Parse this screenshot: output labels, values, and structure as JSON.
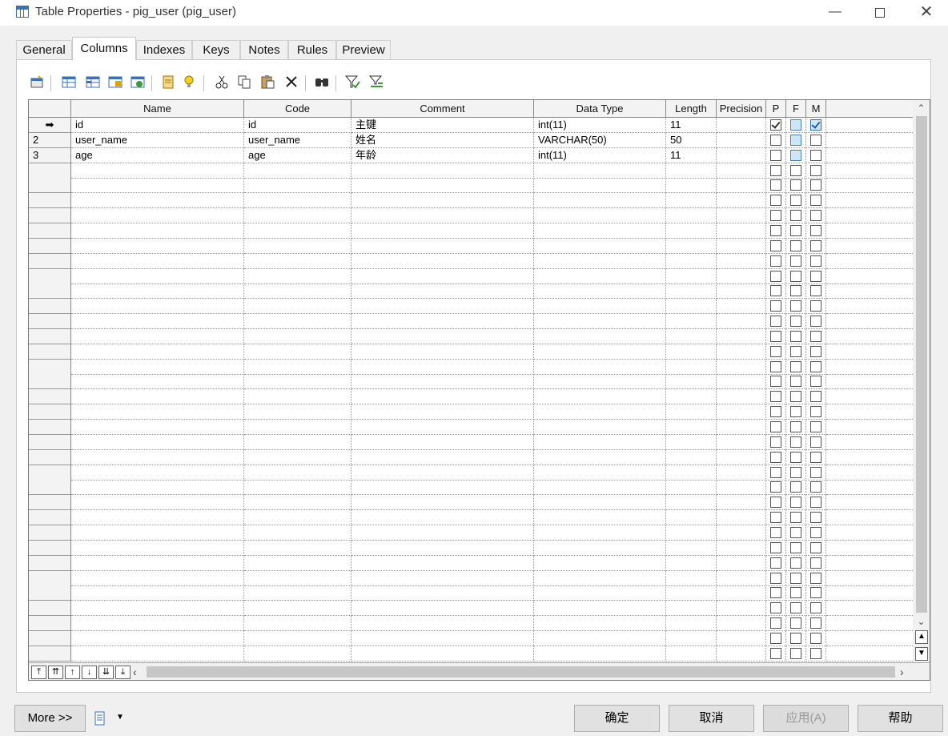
{
  "window": {
    "title": "Table Properties - pig_user (pig_user)"
  },
  "tabs": [
    "General",
    "Columns",
    "Indexes",
    "Keys",
    "Notes",
    "Rules",
    "Preview"
  ],
  "active_tab": "Columns",
  "grid": {
    "headers": [
      "Name",
      "Code",
      "Comment",
      "Data Type",
      "Length",
      "Precision",
      "P",
      "F",
      "M"
    ],
    "rows": [
      {
        "marker": "➡",
        "name": "id",
        "code": "id",
        "comment": "主键",
        "data_type": "int(11)",
        "length": "11",
        "precision": "",
        "p": true,
        "f": false,
        "m": true
      },
      {
        "marker": "2",
        "name": "user_name",
        "code": "user_name",
        "comment": "姓名",
        "data_type": "VARCHAR(50)",
        "length": "50",
        "precision": "",
        "p": false,
        "f": false,
        "m": false
      },
      {
        "marker": "3",
        "name": "age",
        "code": "age",
        "comment": "年龄",
        "data_type": "int(11)",
        "length": "11",
        "precision": "",
        "p": false,
        "f": false,
        "m": false
      }
    ]
  },
  "buttons": {
    "more": "More >>",
    "ok": "确定",
    "cancel": "取消",
    "apply": "应用(A)",
    "help": "帮助"
  }
}
